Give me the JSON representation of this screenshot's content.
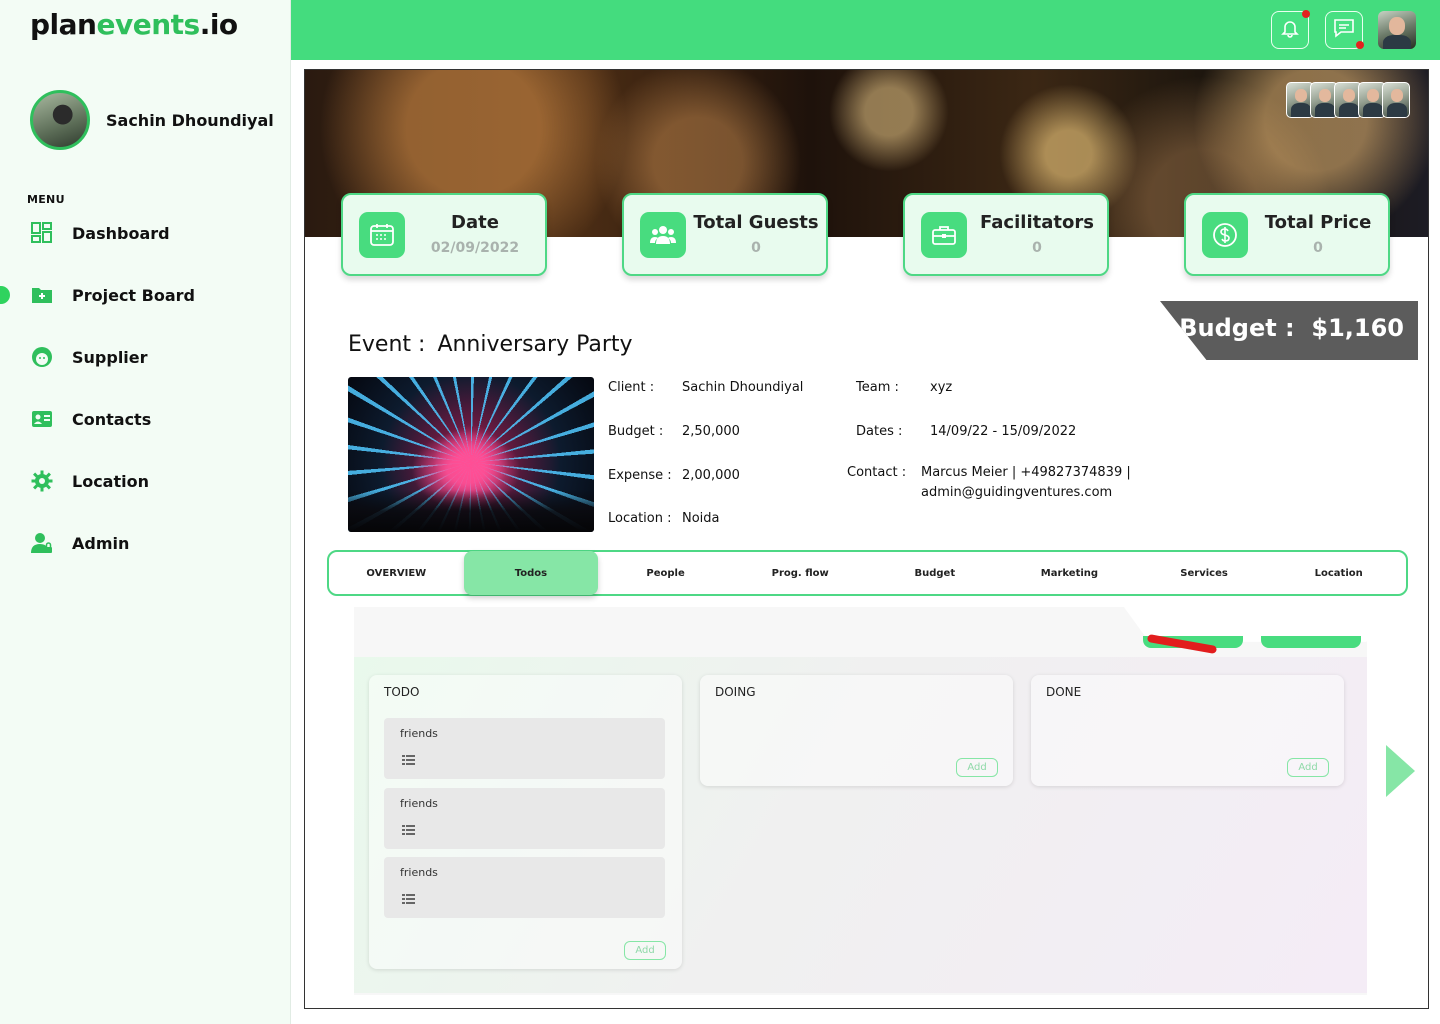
{
  "app": {
    "logo_part1": "plan",
    "logo_part2": "events",
    "logo_part3": ".io"
  },
  "user": {
    "name": "Sachin Dhoundiyal"
  },
  "sidebar": {
    "menu_label": "MENU",
    "items": [
      {
        "label": "Dashboard",
        "icon": "grid-icon"
      },
      {
        "label": "Project Board",
        "icon": "folder-add-icon",
        "active": true
      },
      {
        "label": "Supplier",
        "icon": "face-icon"
      },
      {
        "label": "Contacts",
        "icon": "contact-card-icon"
      },
      {
        "label": "Location",
        "icon": "gear-icon"
      },
      {
        "label": "Admin",
        "icon": "user-lock-icon"
      }
    ]
  },
  "topbar": {
    "notification_icon": "bell-icon",
    "message_icon": "chat-icon",
    "has_notification": true,
    "has_message": true
  },
  "stats": [
    {
      "title": "Date",
      "value": "02/09/2022",
      "icon": "calendar-icon"
    },
    {
      "title": "Total Guests",
      "value": "0",
      "icon": "people-icon"
    },
    {
      "title": "Facilitators",
      "value": "0",
      "icon": "briefcase-icon"
    },
    {
      "title": "Total Price",
      "value": "0",
      "icon": "dollar-icon"
    }
  ],
  "budget_banner": {
    "label": "Budget :",
    "value": "$1,160"
  },
  "event": {
    "label": "Event :",
    "name": "Anniversary Party",
    "client_label": "Client :",
    "client": "Sachin Dhoundiyal",
    "budget_label": "Budget :",
    "budget": "2,50,000",
    "expense_label": "Expense :",
    "expense": "2,00,000",
    "location_label": "Location :",
    "location": "Noida",
    "team_label": "Team :",
    "team": "xyz",
    "dates_label": "Dates :",
    "dates": "14/09/22 - 15/09/2022",
    "contact_label": "Contact :",
    "contact_line1": "Marcus Meier | +49827374839 |",
    "contact_line2": "admin@guidingventures.com"
  },
  "tabs": [
    {
      "label": "OVERVIEW"
    },
    {
      "label": "Todos",
      "active": true
    },
    {
      "label": "People"
    },
    {
      "label": "Prog. flow"
    },
    {
      "label": "Budget"
    },
    {
      "label": "Marketing"
    },
    {
      "label": "Services"
    },
    {
      "label": "Location"
    }
  ],
  "board": {
    "columns": [
      {
        "title": "TODO",
        "cards": [
          "friends",
          "friends",
          "friends"
        ],
        "add_label": "Add"
      },
      {
        "title": "DOING",
        "cards": [],
        "add_label": "Add"
      },
      {
        "title": "DONE",
        "cards": [],
        "add_label": "Add"
      }
    ]
  },
  "colors": {
    "accent": "#44dc7e",
    "accent_dark": "#2fbf5c",
    "accent_light": "#86e6a6",
    "banner": "#5c5c5c"
  }
}
